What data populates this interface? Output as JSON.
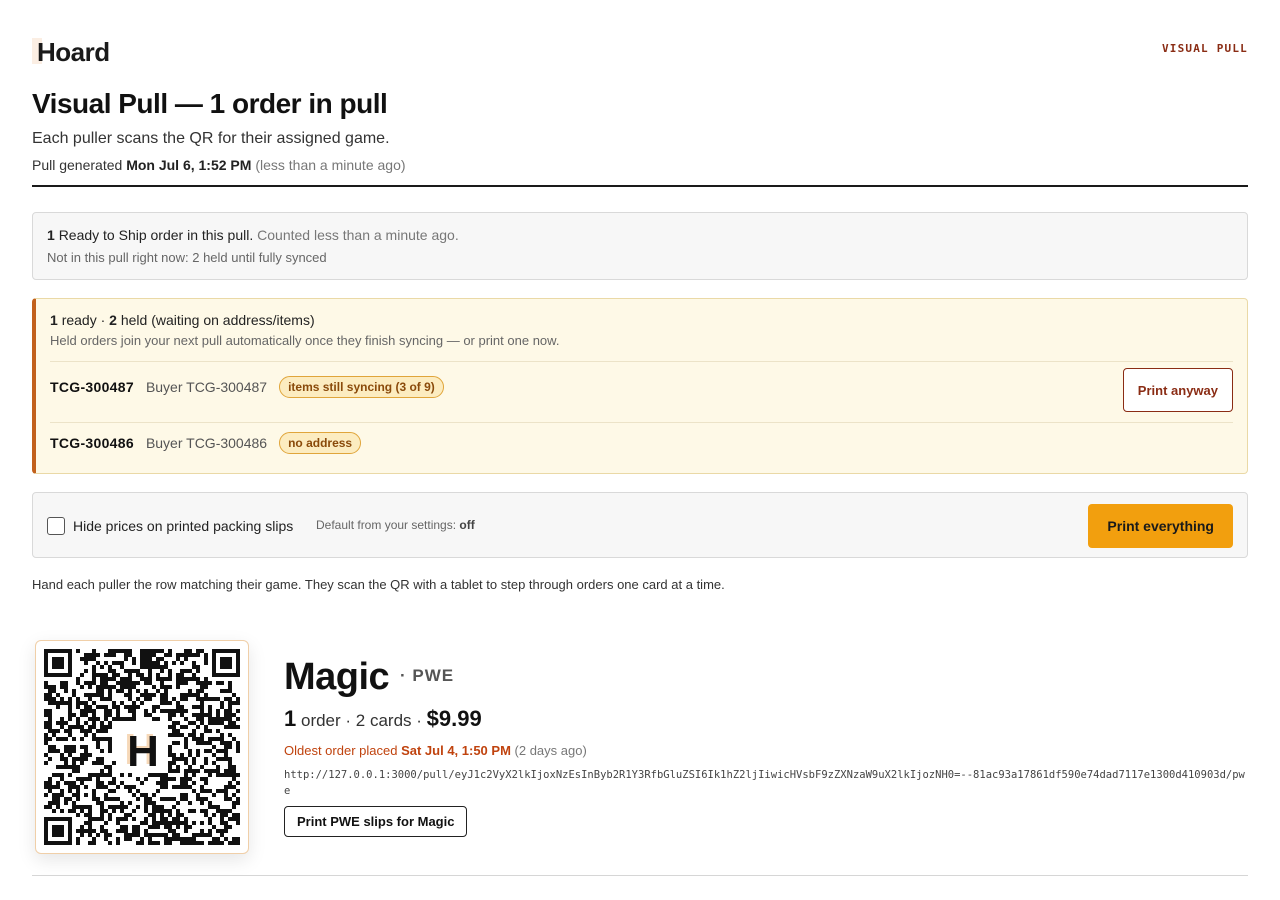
{
  "header": {
    "logo_text": "Hoard",
    "tag": "VISUAL PULL"
  },
  "page": {
    "title": "Visual Pull — 1 order in pull",
    "subtitle": "Each puller scans the QR for their assigned game.",
    "generated_prefix": "Pull generated",
    "generated_time": "Mon Jul 6, 1:52 PM",
    "generated_relative": "(less than a minute ago)"
  },
  "summary": {
    "ready_count": "1",
    "ready_text": "Ready to Ship order in this pull.",
    "counted_text": "Counted less than a minute ago.",
    "excluded_text": "Not in this pull right now: 2 held until fully synced"
  },
  "held": {
    "ready_count": "1",
    "ready_label": "ready ·",
    "held_count": "2",
    "held_label": "held (waiting on address/items)",
    "description": "Held orders join your next pull automatically once they finish syncing — or print one now.",
    "rows": [
      {
        "order_id": "TCG-300487",
        "buyer": "Buyer TCG-300487",
        "badge": "items still syncing (3 of 9)",
        "action": "Print anyway"
      },
      {
        "order_id": "TCG-300486",
        "buyer": "Buyer TCG-300486",
        "badge": "no address"
      }
    ]
  },
  "options": {
    "hide_prices_label": "Hide prices on printed packing slips",
    "hide_prices_checked": false,
    "default_prefix": "Default from your settings:",
    "default_value": "off",
    "print_all_label": "Print everything"
  },
  "instructions": "Hand each puller the row matching their game. They scan the QR with a tablet to step through orders one card at a time.",
  "games": [
    {
      "name": "Magic",
      "shipping": "· PWE",
      "order_count": "1",
      "order_label": "order · 2 cards ·",
      "total": "$9.99",
      "oldest_prefix": "Oldest order placed",
      "oldest_date": "Sat Jul 4, 1:50 PM",
      "oldest_relative": "(2 days ago)",
      "url": "http://127.0.0.1:3000/pull/eyJ1c2VyX2lkIjoxNzEsInByb2R1Y3RfbGluZSI6Ik1hZ2ljIiwicHVsbF9zZXNzaW9uX2lkIjozNH0=--81ac93a17861df590e74dad7117e1300d410903d/pwe",
      "qr_center_letter": "H",
      "print_label": "Print PWE slips for Magic"
    }
  ],
  "colors": {
    "accent_orange": "#f29f0e",
    "brand_brown": "#8a2c14",
    "warning_bg": "#fef9e7",
    "warning_border": "#c2611c",
    "date_red": "#c0430e"
  }
}
